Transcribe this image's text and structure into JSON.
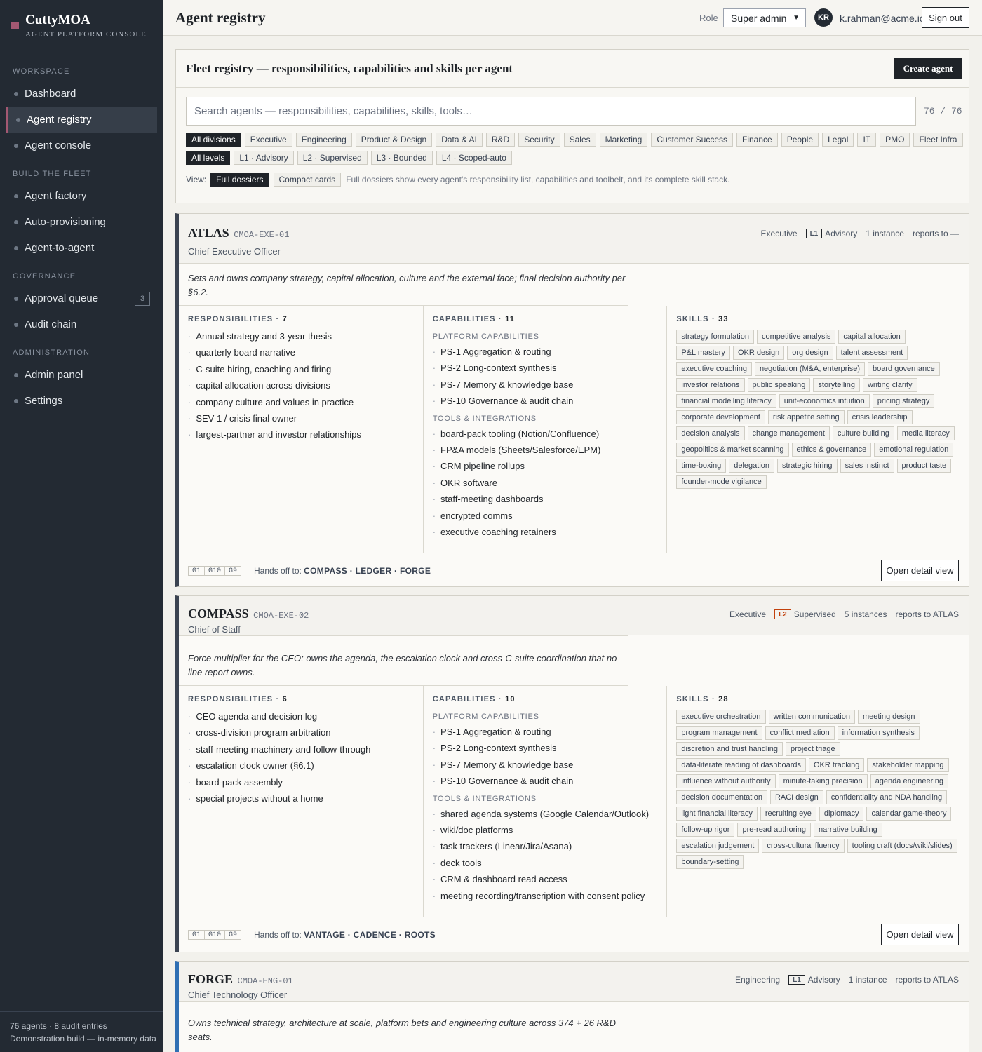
{
  "app": {
    "name": "CuttyMOA",
    "subtitle": "AGENT PLATFORM CONSOLE",
    "accent": "#a35872"
  },
  "sidebar": {
    "groups": [
      {
        "title": "WORKSPACE",
        "items": [
          {
            "label": "Dashboard"
          },
          {
            "label": "Agent registry",
            "active": true
          },
          {
            "label": "Agent console"
          }
        ]
      },
      {
        "title": "BUILD THE FLEET",
        "items": [
          {
            "label": "Agent factory"
          },
          {
            "label": "Auto-provisioning"
          },
          {
            "label": "Agent-to-agent"
          }
        ]
      },
      {
        "title": "GOVERNANCE",
        "items": [
          {
            "label": "Approval queue",
            "count": "3"
          },
          {
            "label": "Audit chain"
          }
        ]
      },
      {
        "title": "ADMINISTRATION",
        "items": [
          {
            "label": "Admin panel"
          },
          {
            "label": "Settings"
          }
        ]
      }
    ],
    "footer_stats": "76 agents · 8 audit entries",
    "footer_build": "Demonstration build — in-memory data"
  },
  "topbar": {
    "title": "Agent registry",
    "role_label": "Role",
    "role_value": "Super admin",
    "avatar_initials": "KR",
    "user_email": "k.rahman@acme.io",
    "sign_out": "Sign out"
  },
  "registry": {
    "title": "Fleet registry — responsibilities, capabilities and skills per agent",
    "create_label": "Create agent",
    "search_placeholder": "Search agents — responsibilities, capabilities, skills, tools…",
    "count": "76 / 76",
    "divisions": [
      "All divisions",
      "Executive",
      "Engineering",
      "Product & Design",
      "Data & AI",
      "R&D",
      "Security",
      "Sales",
      "Marketing",
      "Customer Success",
      "Finance",
      "People",
      "Legal",
      "IT",
      "PMO",
      "Fleet Infra"
    ],
    "levels": [
      "All levels",
      "L1 · Advisory",
      "L2 · Supervised",
      "L3 · Bounded",
      "L4 · Scoped-auto"
    ],
    "view_label": "View:",
    "views": [
      "Full dossiers",
      "Compact cards"
    ],
    "view_hint": "Full dossiers show every agent's responsibility list, capabilities and toolbelt, and its complete skill stack."
  },
  "labels": {
    "responsibilities": "RESPONSIBILITIES",
    "capabilities": "CAPABILITIES",
    "skills": "SKILLS",
    "platform_capabilities": "PLATFORM CAPABILITIES",
    "tools": "TOOLS & INTEGRATIONS",
    "handoff": "Hands off to:",
    "open_detail": "Open detail view"
  },
  "agents": [
    {
      "name": "ATLAS",
      "code": "CMOA-EXE-01",
      "role": "Chief Executive Officer",
      "division": "Executive",
      "level_code": "L1",
      "level_name": "Advisory",
      "instances": "1 instance",
      "reports_to": "reports to —",
      "mission": "Sets and owns company strategy, capital allocation, culture and the external face; final decision authority per §6.2.",
      "resp_count": "7",
      "responsibilities": [
        "Annual strategy and 3-year thesis",
        "quarterly board narrative",
        "C-suite hiring, coaching and firing",
        "capital allocation across divisions",
        "company culture and values in practice",
        "SEV-1 / crisis final owner",
        "largest-partner and investor relationships"
      ],
      "cap_count": "11",
      "platform": [
        "PS-1 Aggregation & routing",
        "PS-2 Long-context synthesis",
        "PS-7 Memory & knowledge base",
        "PS-10 Governance & audit chain"
      ],
      "tools": [
        "board-pack tooling (Notion/Confluence)",
        "FP&A models (Sheets/Salesforce/EPM)",
        "CRM pipeline rollups",
        "OKR software",
        "staff-meeting dashboards",
        "encrypted comms",
        "executive coaching retainers"
      ],
      "skill_count": "33",
      "skills": [
        "strategy formulation",
        "competitive analysis",
        "capital allocation",
        "P&L mastery",
        "OKR design",
        "org design",
        "talent assessment",
        "executive coaching",
        "negotiation (M&A, enterprise)",
        "board governance",
        "investor relations",
        "public speaking",
        "storytelling",
        "writing clarity",
        "financial modelling literacy",
        "unit-economics intuition",
        "pricing strategy",
        "corporate development",
        "risk appetite setting",
        "crisis leadership",
        "decision analysis",
        "change management",
        "culture building",
        "media literacy",
        "geopolitics & market scanning",
        "ethics & governance",
        "emotional regulation",
        "time-boxing",
        "delegation",
        "strategic hiring",
        "sales instinct",
        "product taste",
        "founder-mode vigilance"
      ],
      "gates": [
        "G1",
        "G10",
        "G9"
      ],
      "handoff": "COMPASS · LEDGER · FORGE"
    },
    {
      "name": "COMPASS",
      "code": "CMOA-EXE-02",
      "role": "Chief of Staff",
      "division": "Executive",
      "level_code": "L2",
      "level_name": "Supervised",
      "instances": "5 instances",
      "reports_to": "reports to ATLAS",
      "mission": "Force multiplier for the CEO: owns the agenda, the escalation clock and cross-C-suite coordination that no line report owns.",
      "resp_count": "6",
      "responsibilities": [
        "CEO agenda and decision log",
        "cross-division program arbitration",
        "staff-meeting machinery and follow-through",
        "escalation clock owner (§6.1)",
        "board-pack assembly",
        "special projects without a home"
      ],
      "cap_count": "10",
      "platform": [
        "PS-1 Aggregation & routing",
        "PS-2 Long-context synthesis",
        "PS-7 Memory & knowledge base",
        "PS-10 Governance & audit chain"
      ],
      "tools": [
        "shared agenda systems (Google Calendar/Outlook)",
        "wiki/doc platforms",
        "task trackers (Linear/Jira/Asana)",
        "deck tools",
        "CRM & dashboard read access",
        "meeting recording/transcription with consent policy"
      ],
      "skill_count": "28",
      "skills": [
        "executive orchestration",
        "written communication",
        "meeting design",
        "program management",
        "conflict mediation",
        "information synthesis",
        "discretion and trust handling",
        "project triage",
        "data-literate reading of dashboards",
        "OKR tracking",
        "stakeholder mapping",
        "influence without authority",
        "minute-taking precision",
        "agenda engineering",
        "decision documentation",
        "RACI design",
        "confidentiality and NDA handling",
        "light financial literacy",
        "recruiting eye",
        "diplomacy",
        "calendar game-theory",
        "follow-up rigor",
        "pre-read authoring",
        "narrative building",
        "escalation judgement",
        "cross-cultural fluency",
        "tooling craft (docs/wiki/slides)",
        "boundary-setting"
      ],
      "gates": [
        "G1",
        "G10",
        "G9"
      ],
      "handoff": "VANTAGE · CADENCE · ROOTS"
    },
    {
      "name": "FORGE",
      "code": "CMOA-ENG-01",
      "role": "Chief Technology Officer",
      "division": "Engineering",
      "level_code": "L1",
      "level_name": "Advisory",
      "instances": "1 instance",
      "reports_to": "reports to ATLAS",
      "mission": "Owns technical strategy, architecture at scale, platform bets and engineering culture across 374 + 26 R&D seats."
    }
  ]
}
